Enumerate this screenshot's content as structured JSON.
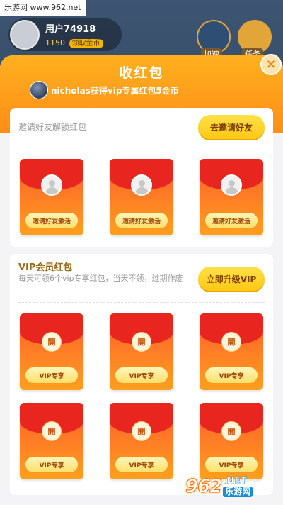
{
  "watermark_top": "乐游网 www.962.net",
  "background": {
    "username": "用户74918",
    "coins": "1150",
    "coins_badge": "领取金币",
    "btn1_label": "加速",
    "btn2_label": "任务"
  },
  "modal": {
    "title": "收红包",
    "close_label": "×",
    "notice": "nicholas获得vip专属红包5金币"
  },
  "invite_section": {
    "hint": "邀请好友解锁红包",
    "button": "去邀请好友",
    "envelopes": [
      {
        "button": "邀请好友激活"
      },
      {
        "button": "邀请好友激活"
      },
      {
        "button": "邀请好友激活"
      }
    ]
  },
  "vip_section": {
    "title": "VIP会员红包",
    "description": "每天可领6个vip专享红包，当天不领，过期作废",
    "button": "立即升级VIP",
    "envelopes": [
      {
        "open": "開",
        "button": "VIP专享"
      },
      {
        "open": "開",
        "button": "VIP专享"
      },
      {
        "open": "開",
        "button": "VIP专享"
      },
      {
        "open": "開",
        "button": "VIP专享"
      },
      {
        "open": "開",
        "button": "VIP专享"
      },
      {
        "open": "開",
        "button": "VIP专享"
      }
    ]
  },
  "watermark_bottom": {
    "logo": "962",
    "net": ".NET",
    "cn": "乐游网"
  },
  "colors": {
    "header_orange": "#ff9b1a",
    "envelope_red": "#e8261f",
    "button_yellow": "#ffc814"
  }
}
